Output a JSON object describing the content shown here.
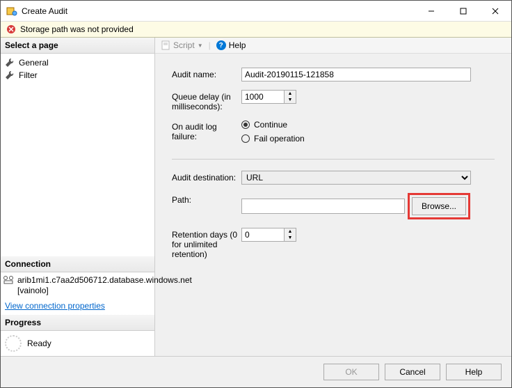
{
  "window": {
    "title": "Create Audit"
  },
  "error": {
    "message": "Storage path was not provided"
  },
  "pages": {
    "header": "Select a page",
    "items": [
      {
        "label": "General"
      },
      {
        "label": "Filter"
      }
    ]
  },
  "connection": {
    "header": "Connection",
    "server": "arib1mi1.c7aa2d506712.database.windows.net [vainolo]",
    "view_props": "View connection properties"
  },
  "progress": {
    "header": "Progress",
    "status": "Ready"
  },
  "toolbar": {
    "script": "Script",
    "help": "Help"
  },
  "form": {
    "audit_name_label": "Audit name:",
    "audit_name_value": "Audit-20190115-121858",
    "queue_delay_label": "Queue delay (in milliseconds):",
    "queue_delay_value": "1000",
    "on_failure_label": "On audit log failure:",
    "on_failure_opts": {
      "continue": "Continue",
      "fail": "Fail operation"
    },
    "audit_dest_label": "Audit destination:",
    "audit_dest_value": "URL",
    "path_label": "Path:",
    "path_value": "",
    "browse": "Browse...",
    "retention_label": "Retention days (0 for unlimited retention)",
    "retention_value": "0"
  },
  "buttons": {
    "ok": "OK",
    "cancel": "Cancel",
    "help": "Help"
  }
}
